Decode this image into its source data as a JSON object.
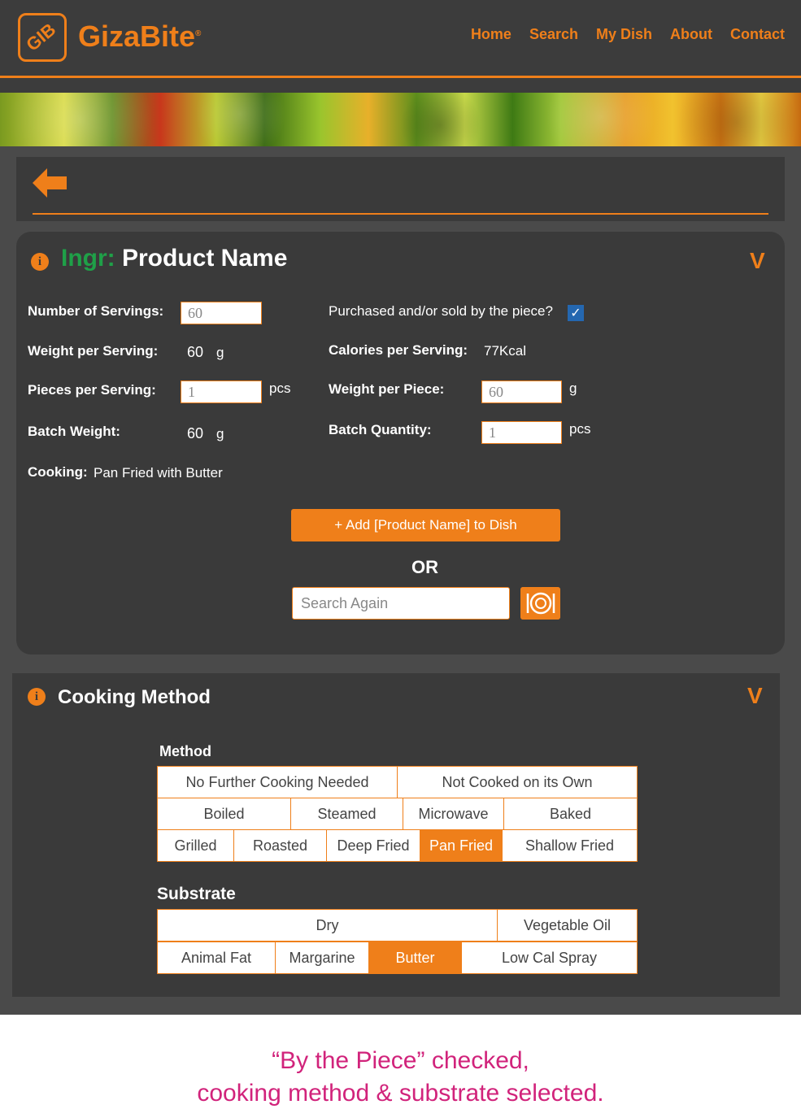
{
  "header": {
    "logo_text": "GIB",
    "brand": "GizaBite",
    "brand_mark": "®",
    "nav": [
      "Home",
      "Search",
      "My Dish",
      "About",
      "Contact"
    ]
  },
  "product": {
    "title_prefix": "Ingr:",
    "title": "Product Name",
    "servings_label": "Number of Servings:",
    "servings_value": "60",
    "weight_per_serving_label": "Weight per Serving:",
    "weight_per_serving_value": "60",
    "weight_per_serving_unit": "g",
    "pieces_label": "Pieces per Serving:",
    "pieces_value": "1",
    "pieces_unit": "pcs",
    "batch_weight_label": "Batch Weight:",
    "batch_weight_value": "60",
    "batch_weight_unit": "g",
    "cooking_label": "Cooking:",
    "cooking_value": "Pan Fried with Butter",
    "by_piece_label": "Purchased and/or sold by the piece?",
    "by_piece_checked": "✓",
    "calories_label": "Calories per Serving:",
    "calories_value": "77Kcal",
    "weight_per_piece_label": "Weight per Piece:",
    "weight_per_piece_value": "60",
    "weight_per_piece_unit": "g",
    "batch_qty_label": "Batch Quantity:",
    "batch_qty_value": "1",
    "batch_qty_unit": "pcs",
    "add_button": "+ Add [Product Name] to Dish",
    "or_text": "OR",
    "search_placeholder": "Search Again"
  },
  "cooking": {
    "title": "Cooking Method",
    "method_heading": "Method",
    "method_rows": [
      [
        "No Further Cooking Needed",
        "Not Cooked on its Own"
      ],
      [
        "Boiled",
        "Steamed",
        "Microwave",
        "Baked"
      ],
      [
        "Grilled",
        "Roasted",
        "Deep Fried",
        "Pan Fried",
        "Shallow Fried"
      ]
    ],
    "method_selected": "Pan Fried",
    "substrate_heading": "Substrate",
    "substrate_rows": [
      [
        "Dry",
        "Vegetable Oil"
      ],
      [
        "Animal Fat",
        "Margarine",
        "Butter",
        "Low Cal Spray"
      ]
    ],
    "substrate_selected": "Butter"
  },
  "caption": {
    "line1": "“By the Piece”  checked,",
    "line2": "cooking method & substrate selected."
  },
  "colors": {
    "accent": "#ef7f1a",
    "ingr_green": "#1fa048",
    "caption": "#d1237b",
    "panel": "#3a3a3a"
  }
}
